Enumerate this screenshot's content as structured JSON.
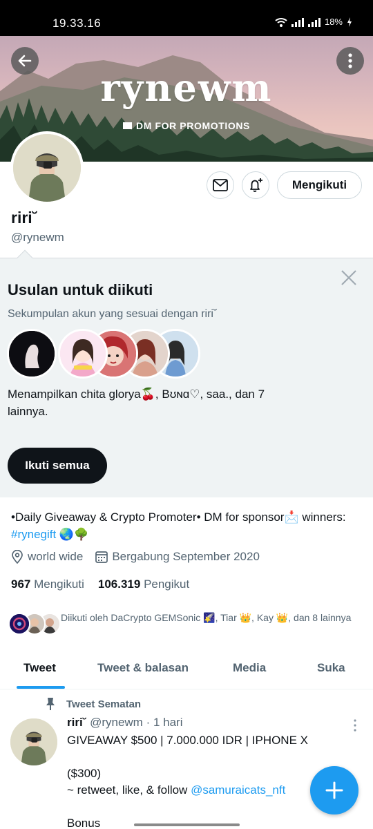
{
  "status_bar": {
    "time": "19.33.16",
    "battery": "18%"
  },
  "banner": {
    "title": "rynewm",
    "subtitle": "DM FOR PROMOTIONS"
  },
  "profile": {
    "name": "riri˘",
    "handle": "@rynewm",
    "follow_button": "Mengikuti",
    "bio_prefix": "•Daily Giveaway & Crypto Promoter• DM for sponsor📩 winners: ",
    "bio_hashtag": "#rynegift",
    "bio_suffix": " 🌏🌳",
    "location": "world wide",
    "joined": "Bergabung September 2020",
    "following_count": "967",
    "following_label": "Mengikuti",
    "followers_count": "106.319",
    "followers_label": "Pengikut",
    "followed_by": "Diikuti oleh DaCrypto GEMSonic 🌠, Tiar 👑, Kay 👑, dan 8 lainnya"
  },
  "suggestions": {
    "title": "Usulan untuk diikuti",
    "subtitle": "Sekumpulan akun yang sesuai dengan riri˘",
    "summary": "Menampilkan chita glorya🍒, Bʊɴɑ♡, saa., dan 7 lainnya.",
    "follow_all_button": "Ikuti semua"
  },
  "tabs": [
    {
      "label": "Tweet",
      "active": true
    },
    {
      "label": "Tweet & balasan",
      "active": false
    },
    {
      "label": "Media",
      "active": false
    },
    {
      "label": "Suka",
      "active": false
    }
  ],
  "tweet": {
    "pinned_label": "Tweet Sematan",
    "name": "riri˘",
    "handle": "@rynewm",
    "time": "· 1 hari",
    "text_1": "GIVEAWAY $500 | 7.000.000 IDR | IPHONE X\n\n($300)\n~ retweet, like, & follow ",
    "mention": "@samuraicats_nft",
    "text_2": "\n\nBonus"
  },
  "colors": {
    "accent": "#1d9bf0",
    "suggest_bg": "#eff3f4",
    "text_secondary": "#536471"
  }
}
